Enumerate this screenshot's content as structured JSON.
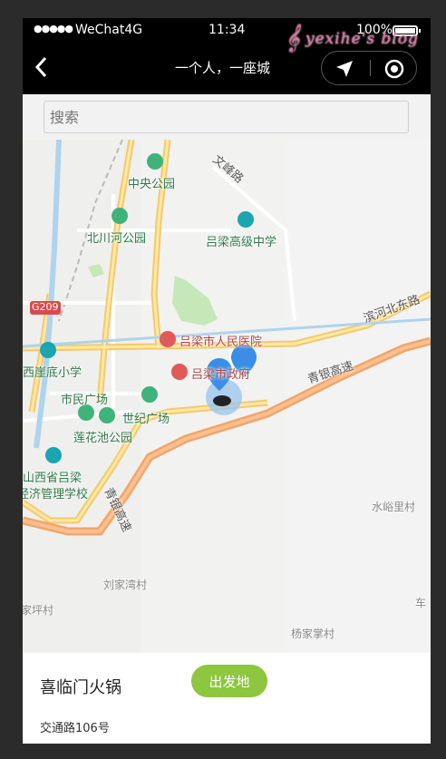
{
  "status_bar": {
    "signal": "●●●●●",
    "carrier": "WeChat4G",
    "time": "11:34",
    "battery": "100%"
  },
  "nav_bar": {
    "title": "一个人，一座城"
  },
  "watermark": {
    "text": "yexihe's blog"
  },
  "search": {
    "placeholder": "搜索"
  },
  "map": {
    "labels": {
      "zhongyang_park": "中央公园",
      "beichuanhe_park": "北川河公园",
      "lvliang_high_school": "吕梁高级中学",
      "wenfeng_road": "文峰路",
      "g209": "G209",
      "binhe_north_road": "滨河北东路",
      "people_hospital": "吕梁市人民医院",
      "government": "吕梁市政府",
      "qingyin_highway": "青银高速",
      "qingyin_highway_2": "青银高速",
      "yaidi_school": "西崖底小学",
      "shimin_square": "市民广场",
      "shiji_square": "世纪广场",
      "lianhuachi_park": "莲花池公园",
      "economic_school_1": "山西省吕梁",
      "economic_school_2": "经济管理学校",
      "shuiyuli_village": "水峪里村",
      "liujiawan_village": "刘家湾村",
      "jiaping_village": "家坪村",
      "yangjiazhang_village": "杨家掌村",
      "che_village": "车"
    }
  },
  "bottom_panel": {
    "place_name": "喜临门火锅",
    "address": "交通路106号",
    "start_button": "出发地"
  },
  "colors": {
    "accent_green": "#8dc63f",
    "marker_blue": "#3a8ee6",
    "highway": "#f6b27a",
    "major_road": "#fbd98a"
  }
}
